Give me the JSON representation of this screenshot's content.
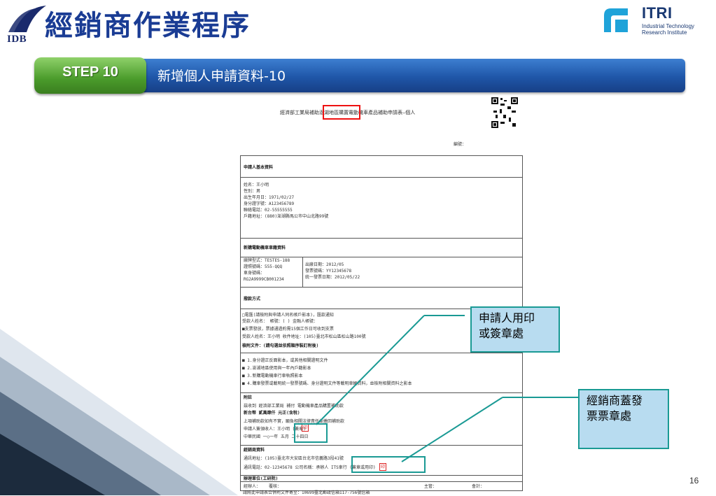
{
  "header": {
    "org_logo_text": "IDB",
    "title": "經銷商作業程序",
    "partner": {
      "name": "ITRI",
      "line1": "Industrial Technology",
      "line2": "Research Institute"
    }
  },
  "banner": {
    "step": "STEP 10",
    "subtitle": "新增個人申請資料-10"
  },
  "document": {
    "form_title": "經濟部工業局補助澎湖地區購置電動機車產品補助申請表—個人",
    "serial_label": "編號：",
    "applicant_section": "申請人基本資料",
    "applicant_lines": [
      "姓名：王小明",
      "性別：男",
      "出生年月日：1971/02/27",
      "身分證字號：A123456789",
      "聯絡電話：02-55555555",
      "戶籍地址：(880)澎湖縣馬公市中山北路99號"
    ],
    "vehicle_section": "新購電動機車車籍資料",
    "vehicle_left": [
      "廠牌型式：TESTES-188",
      "證照號碼：555-QQQ",
      "車身號碼：",
      "RG2A9999CB001234"
    ],
    "vehicle_right": [
      "出廠日期：2012/05",
      "發票號碼：YY12345678",
      "統一發票日期：2012/05/22"
    ],
    "payment_section": "撥款方式",
    "payment_lines": [
      "□電匯(請檢附與申請人同名帳戶影本)，匯款通知",
      "受款人姓名： 帳號：( ) 金融人帳號：",
      "■支票發放，票據通過約需15個工作日可收到支票",
      "受款人姓名：王小明 收件地址：(105)臺北市松山區松山路100號"
    ],
    "attachment_label": "檢附文件：(請勾選並依照順序裝訂附後)",
    "attachment_lines": [
      "■ 1.身分證正反面影本，或其他相關證明文件",
      "■ 2.澎湖地區使用與一年內戶籍影本",
      "■ 3.新購電動機車行車執照影本",
      "■ 4.購車發票或載明統一發票號碼、身分證明文件等載明車輛資料，並檢附相關資料之影本"
    ],
    "remark_section": "附註",
    "remark_line1": "茲收到 經濟部工業局 補付 電動機車產品購置補助款",
    "remark_line2": "新台幣 貳萬肆仟 元正(含稅)",
    "remark_line3": "上項補助款如有不實，願負相關法律責任並繳回補助款",
    "remark_line4": "申請人簽領收人：王小明 (簽章)",
    "remark_line5": "中華民國 一○一年 五月 二十四日",
    "dealer_section": "經銷商資料",
    "dealer_line1": "通訊地址：(105)臺北市大安區台北市信義路3段41號",
    "dealer_line2": "通訊電話：02-12345678 公司名稱：承辦人 ITS車行 (簽章或用印)",
    "office_section": "辦理單位(工研院)",
    "office_cols": [
      "經辦人：",
      "覆核：",
      "主管：",
      "會計："
    ],
    "footer_note": "請將此申請表合併附文件寄至：10699臺北郵政信箱117-756號信箱",
    "seal_char": "印"
  },
  "callouts": {
    "applicant_seal": "申請人用印\n或簽章處",
    "dealer_seal": "經銷商蓋發\n票票章處"
  },
  "page_number": "16"
}
